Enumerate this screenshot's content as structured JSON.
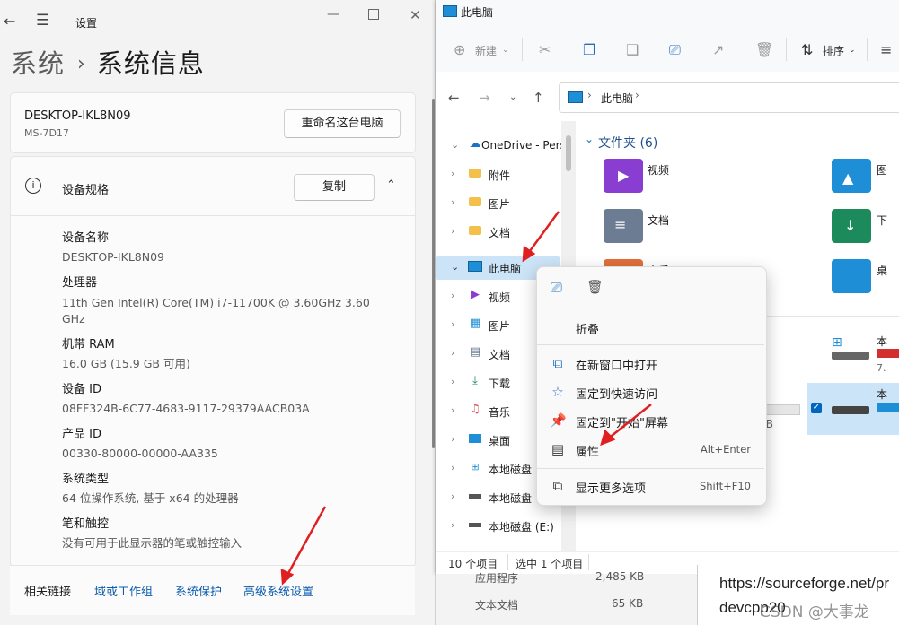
{
  "settings": {
    "window_title": "设置",
    "breadcrumb_parent": "系统",
    "breadcrumb_current": "系统信息",
    "device_name": "DESKTOP-IKL8N09",
    "device_model": "MS-7D17",
    "rename_button": "重命名这台电脑",
    "spec_section_title": "设备规格",
    "copy_button": "复制",
    "specs": [
      {
        "label": "设备名称",
        "value": "DESKTOP-IKL8N09"
      },
      {
        "label": "处理器",
        "value": "11th Gen Intel(R) Core(TM) i7-11700K @ 3.60GHz   3.60 GHz"
      },
      {
        "label": "机带 RAM",
        "value": "16.0 GB (15.9 GB 可用)"
      },
      {
        "label": "设备 ID",
        "value": "08FF324B-6C77-4683-9117-29379AACB03A"
      },
      {
        "label": "产品 ID",
        "value": "00330-80000-00000-AA335"
      },
      {
        "label": "系统类型",
        "value": "64 位操作系统, 基于 x64 的处理器"
      },
      {
        "label": "笔和触控",
        "value": "没有可用于此显示器的笔或触控输入"
      }
    ],
    "related_links_title": "相关链接",
    "related_links": [
      "域或工作组",
      "系统保护",
      "高级系统设置"
    ]
  },
  "explorer": {
    "window_title": "此电脑",
    "toolbar": {
      "new_label": "新建",
      "sort_label": "排序"
    },
    "address": "此电脑",
    "nav_items": [
      {
        "label": "OneDrive - Pers",
        "icon": "cloud-icon"
      },
      {
        "label": "附件",
        "icon": "folder-icon"
      },
      {
        "label": "图片",
        "icon": "folder-icon"
      },
      {
        "label": "文档",
        "icon": "folder-icon"
      },
      {
        "label": "此电脑",
        "icon": "computer-icon"
      },
      {
        "label": "视频",
        "icon": "video-icon"
      },
      {
        "label": "图片",
        "icon": "pictures-icon"
      },
      {
        "label": "文档",
        "icon": "documents-icon"
      },
      {
        "label": "下载",
        "icon": "download-icon"
      },
      {
        "label": "音乐",
        "icon": "music-icon"
      },
      {
        "label": "桌面",
        "icon": "desktop-icon"
      },
      {
        "label": "本地磁盘",
        "icon": "windows-drive-icon"
      },
      {
        "label": "本地磁盘",
        "icon": "drive-icon"
      },
      {
        "label": "本地磁盘 (E:)",
        "icon": "drive-icon"
      }
    ],
    "folders_header": "文件夹 (6)",
    "folders": [
      {
        "label": "视频",
        "icon": "video-folder-icon"
      },
      {
        "label": "图",
        "icon": "pictures-folder-icon"
      },
      {
        "label": "文档",
        "icon": "documents-folder-icon"
      },
      {
        "label": "下",
        "icon": "download-folder-icon"
      },
      {
        "label": "音乐",
        "icon": "music-folder-icon"
      },
      {
        "label": "桌",
        "icon": "desktop-folder-icon"
      }
    ],
    "drives": [
      {
        "label": "本",
        "size": "7."
      },
      {
        "label": "本",
        "size": ""
      }
    ],
    "drive_partial_size": "2 GB",
    "status_items": "10 个项目",
    "status_selected": "选中 1 个项目"
  },
  "context_menu": {
    "items": [
      {
        "label": "折叠",
        "shortcut": "",
        "icon": ""
      },
      {
        "label": "在新窗口中打开",
        "shortcut": "",
        "icon": "open-new-window-icon"
      },
      {
        "label": "固定到快速访问",
        "shortcut": "",
        "icon": "star-icon"
      },
      {
        "label": "固定到\"开始\"屏幕",
        "shortcut": "",
        "icon": "pin-icon"
      },
      {
        "label": "属性",
        "shortcut": "Alt+Enter",
        "icon": "properties-icon"
      },
      {
        "label": "显示更多选项",
        "shortcut": "Shift+F10",
        "icon": "more-options-icon"
      }
    ]
  },
  "background": {
    "rows": [
      {
        "name": "应用程序",
        "size": "2,485 KB"
      },
      {
        "name": "文本文档",
        "size": "65 KB"
      }
    ],
    "url_line1": "https://sourceforge.net/pr",
    "url_line2": "devcpp20",
    "watermark": "CSDN @大事龙"
  },
  "colors": {
    "accent": "#0067c0",
    "selection": "#cce4f7",
    "annotation": "#e02020"
  }
}
